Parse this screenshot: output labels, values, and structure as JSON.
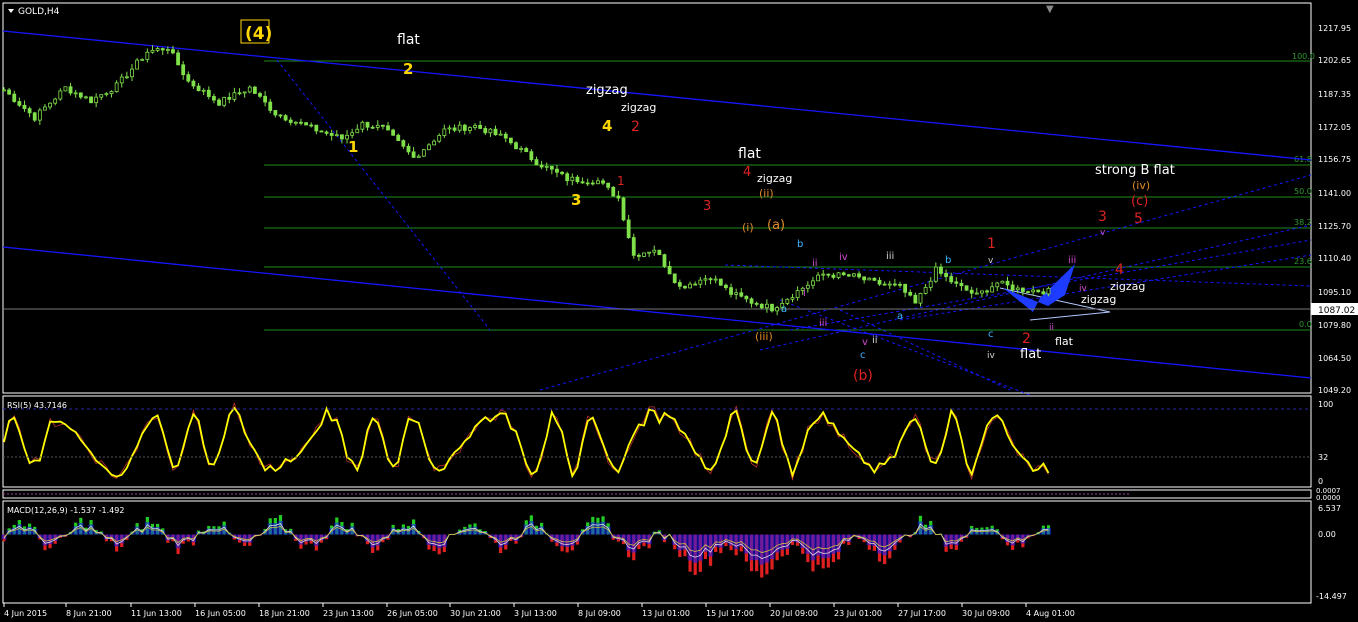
{
  "window": {
    "symbol_label": "GOLD,H4",
    "colors": {
      "background": "#000000",
      "grid_border": "#ffffff",
      "bull_candle": "#7fe04a",
      "trendline": "#1515ff",
      "fib": "#1f8a1f",
      "current_price_line": "#888888"
    }
  },
  "price_panel": {
    "price_axis": [
      "1217.95",
      "1202.65",
      "1187.35",
      "1172.05",
      "1156.75",
      "1141.00",
      "1125.70",
      "1110.40",
      "1095.10",
      "1079.80",
      "1064.50",
      "1049.20"
    ],
    "current_price": "1087.02",
    "fib_levels": [
      "100.0",
      "61.8",
      "50.0",
      "38.2",
      "23.6",
      "0.0"
    ],
    "ylim": [
      1040,
      1224
    ]
  },
  "wave_labels": {
    "w4_big": "(4)",
    "flat": "flat",
    "zigzag": "zigzag",
    "strong_b_flat": "strong B flat",
    "n1": "1",
    "n2": "2",
    "n3": "3",
    "n4": "4",
    "n5": "5",
    "r_i": "(i)",
    "r_ii": "(ii)",
    "r_iii": "(iii)",
    "r_iv": "(iv)",
    "a_paren": "(a)",
    "b_paren": "(b)",
    "c_paren": "(c)",
    "a": "a",
    "b": "b",
    "c": "c",
    "i": "i",
    "ii": "ii",
    "iii": "iii",
    "iv": "iv",
    "v": "v"
  },
  "rsi_panel": {
    "title": "RSI(5) 43.7146",
    "axis": [
      "100",
      "32",
      "0"
    ]
  },
  "mid_panel": {
    "axis": [
      "0.0007",
      "0.0000"
    ]
  },
  "macd_panel": {
    "title": "MACD(12,26,9) -1.537 -1.492",
    "axis": [
      "6.537",
      "0.00",
      "-14.497"
    ]
  },
  "time_axis": [
    "4 Jun 2015",
    "8 Jun 21:00",
    "11 Jun 13:00",
    "16 Jun 05:00",
    "18 Jun 21:00",
    "23 Jun 13:00",
    "26 Jun 05:00",
    "30 Jun 21:00",
    "3 Jul 13:00",
    "8 Jul 09:00",
    "13 Jul 01:00",
    "15 Jul 17:00",
    "20 Jul 09:00",
    "23 Jul 01:00",
    "27 Jul 17:00",
    "30 Jul 09:00",
    "4 Aug 01:00"
  ],
  "chart_data": {
    "type": "candlestick",
    "symbol": "GOLD",
    "timeframe": "H4",
    "ylim": [
      1040,
      1224
    ],
    "current_price": 1087.02,
    "path_points": [
      [
        0,
        1183
      ],
      [
        6,
        1170
      ],
      [
        12,
        1184
      ],
      [
        17,
        1178
      ],
      [
        22,
        1185
      ],
      [
        28,
        1201
      ],
      [
        32,
        1203
      ],
      [
        36,
        1187
      ],
      [
        42,
        1177
      ],
      [
        48,
        1184
      ],
      [
        53,
        1172
      ],
      [
        60,
        1165
      ],
      [
        66,
        1160
      ],
      [
        70,
        1167
      ],
      [
        74,
        1165
      ],
      [
        80,
        1151
      ],
      [
        86,
        1164
      ],
      [
        92,
        1166
      ],
      [
        98,
        1160
      ],
      [
        104,
        1149
      ],
      [
        110,
        1141
      ],
      [
        116,
        1140
      ],
      [
        120,
        1132
      ],
      [
        123,
        1105
      ],
      [
        127,
        1108
      ],
      [
        132,
        1090
      ],
      [
        138,
        1095
      ],
      [
        142,
        1087
      ],
      [
        146,
        1083
      ],
      [
        150,
        1080
      ],
      [
        155,
        1088
      ],
      [
        160,
        1096
      ],
      [
        166,
        1095
      ],
      [
        170,
        1092
      ],
      [
        175,
        1090
      ],
      [
        178,
        1082
      ],
      [
        182,
        1098
      ],
      [
        186,
        1091
      ],
      [
        190,
        1086
      ],
      [
        194,
        1092
      ],
      [
        198,
        1089
      ],
      [
        204,
        1088
      ]
    ],
    "rsi": {
      "value": 43.7146,
      "period": 5,
      "levels": [
        32,
        100
      ]
    },
    "macd": {
      "fast": 12,
      "slow": 26,
      "signal": 9,
      "main": -1.537,
      "signal_value": -1.492,
      "ylim": [
        -14.497,
        6.537
      ]
    }
  }
}
